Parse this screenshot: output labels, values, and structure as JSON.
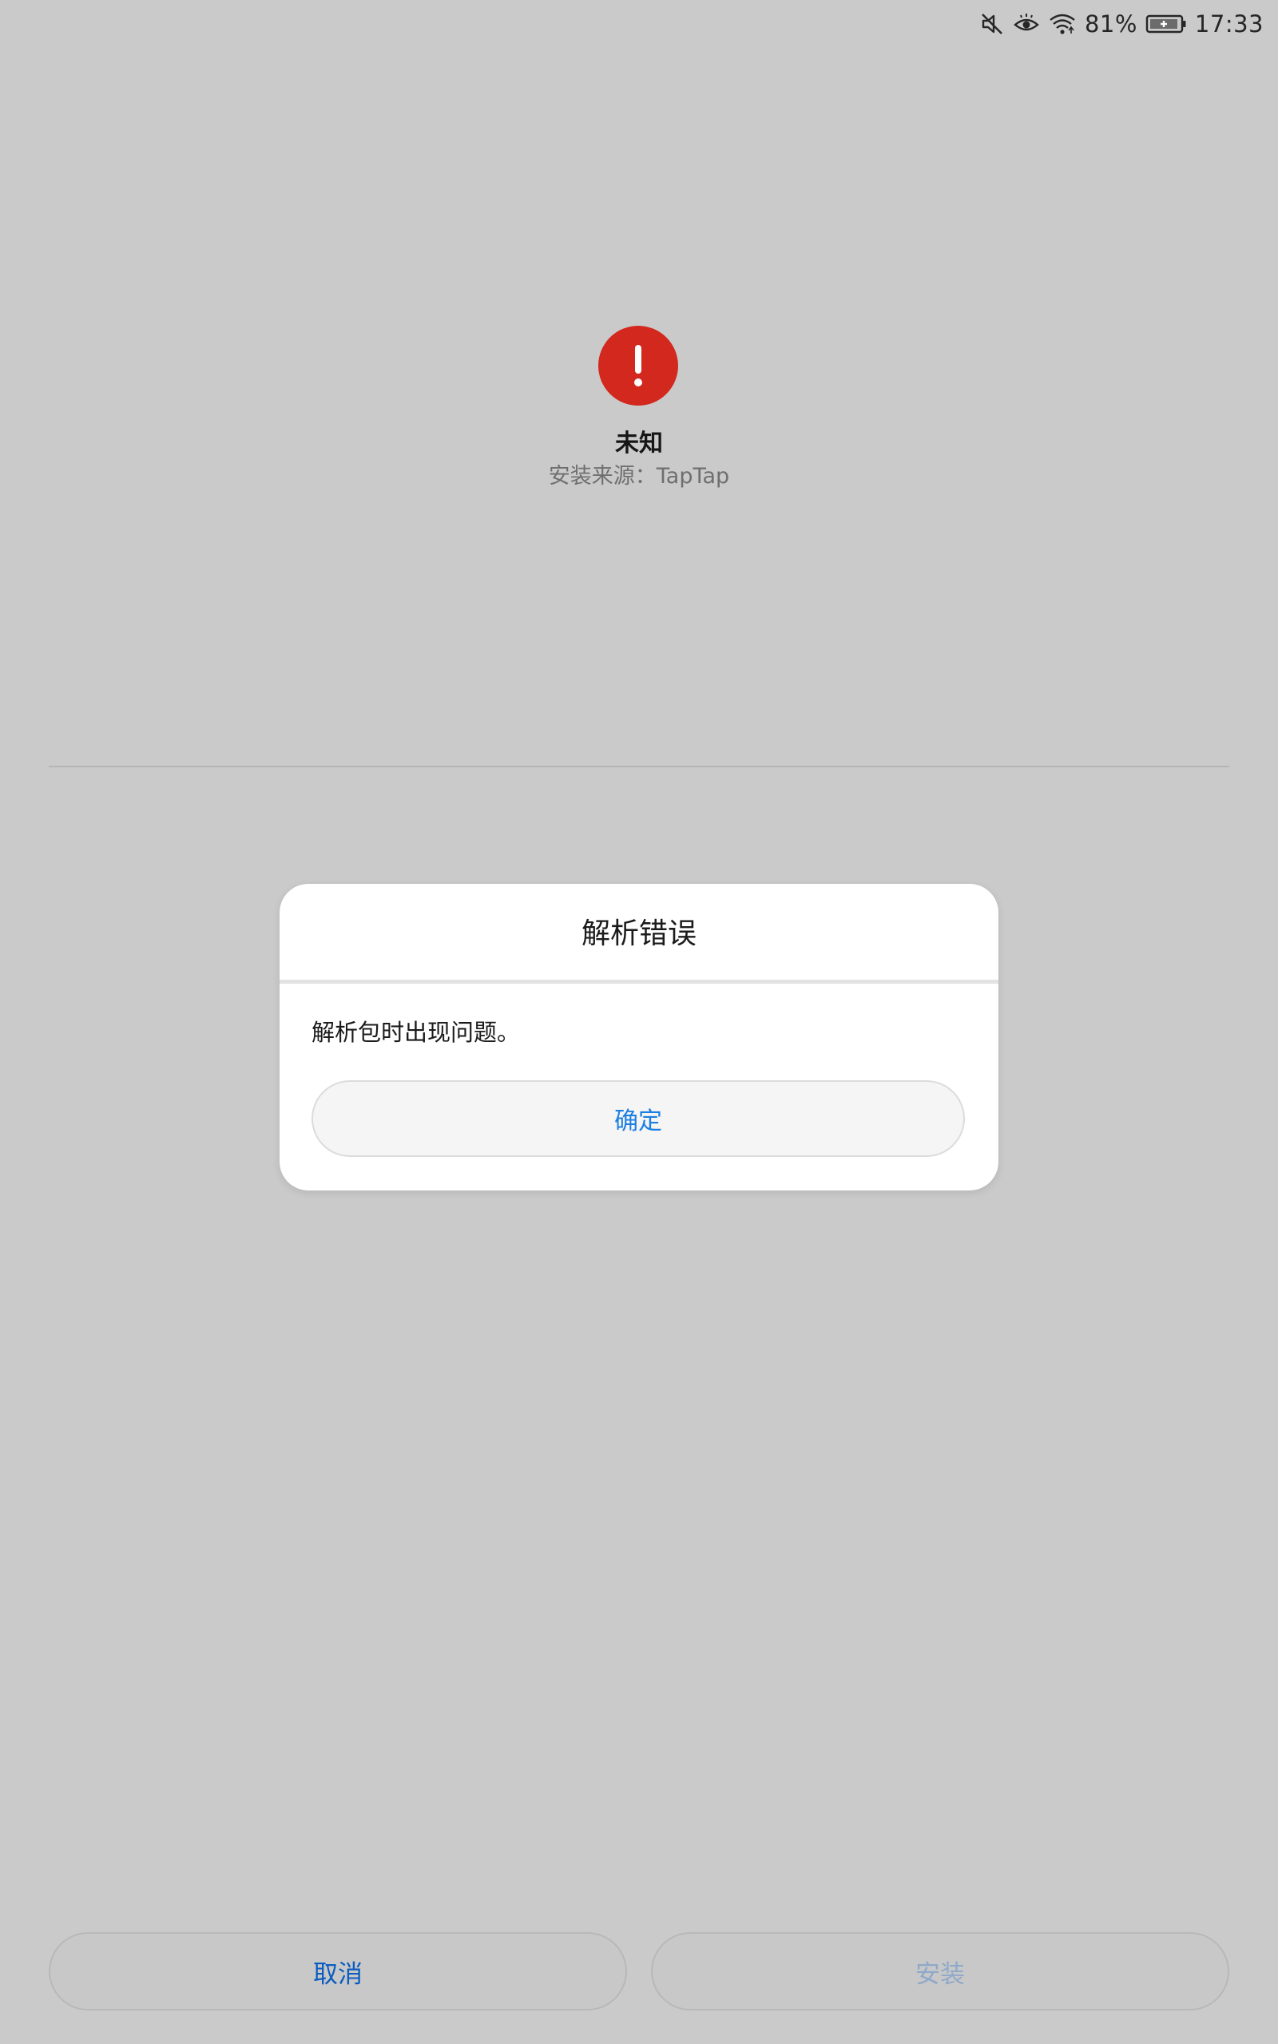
{
  "status_bar": {
    "icons": [
      "mute-icon",
      "eye-comfort-icon",
      "wifi-icon",
      "battery-charging-icon"
    ],
    "battery_percent": "81%",
    "time": "17:33"
  },
  "app": {
    "icon": "error-exclamation-icon",
    "name": "未知",
    "source_label": "安装来源：",
    "source_value": "TapTap"
  },
  "dialog": {
    "title": "解析错误",
    "message": "解析包时出现问题。",
    "ok_label": "确定"
  },
  "buttons": {
    "cancel_label": "取消",
    "install_label": "安装",
    "install_enabled": false
  },
  "colors": {
    "background": "#cacaca",
    "error_red": "#d2281e",
    "accent_blue": "#1b7fe0",
    "cancel_blue": "#0b5cc0",
    "disabled_blue": "#8fa9c9"
  }
}
